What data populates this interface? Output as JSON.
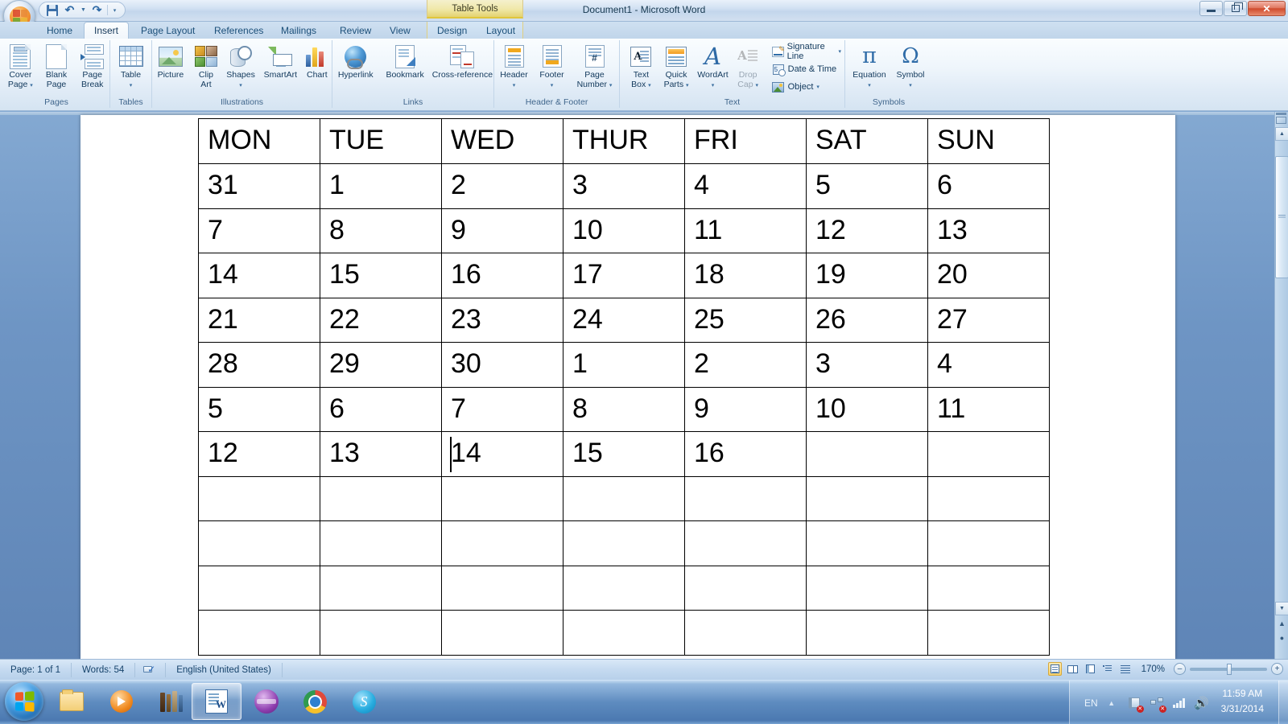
{
  "window": {
    "title": "Document1 - Microsoft Word",
    "contextual_tab_group": "Table Tools",
    "minimize_label": "Minimize",
    "restore_label": "Restore",
    "close_label": "Close"
  },
  "quick_access": {
    "save": "save-icon",
    "undo": "undo-icon",
    "redo": "redo-icon",
    "customize": "customize-icon"
  },
  "tabs": [
    {
      "label": "Home",
      "active": false
    },
    {
      "label": "Insert",
      "active": true
    },
    {
      "label": "Page Layout",
      "active": false
    },
    {
      "label": "References",
      "active": false
    },
    {
      "label": "Mailings",
      "active": false
    },
    {
      "label": "Review",
      "active": false
    },
    {
      "label": "View",
      "active": false
    },
    {
      "label": "Design",
      "active": false
    },
    {
      "label": "Layout",
      "active": false
    }
  ],
  "ribbon": {
    "groups": [
      {
        "name": "Pages",
        "buttons": [
          {
            "label": "Cover\nPage",
            "label_l1": "Cover",
            "label_l2": "Page",
            "dropdown": true
          },
          {
            "label_l1": "Blank",
            "label_l2": "Page",
            "dropdown": false
          },
          {
            "label_l1": "Page",
            "label_l2": "Break",
            "dropdown": false
          }
        ]
      },
      {
        "name": "Tables",
        "buttons": [
          {
            "label_l1": "Table",
            "label_l2": "",
            "dropdown": true
          }
        ]
      },
      {
        "name": "Illustrations",
        "buttons": [
          {
            "label_l1": "Picture",
            "label_l2": "",
            "dropdown": false
          },
          {
            "label_l1": "Clip",
            "label_l2": "Art",
            "dropdown": false
          },
          {
            "label_l1": "Shapes",
            "label_l2": "",
            "dropdown": true
          },
          {
            "label_l1": "SmartArt",
            "label_l2": "",
            "dropdown": false
          },
          {
            "label_l1": "Chart",
            "label_l2": "",
            "dropdown": false
          }
        ]
      },
      {
        "name": "Links",
        "buttons": [
          {
            "label_l1": "Hyperlink",
            "label_l2": "",
            "dropdown": false
          },
          {
            "label_l1": "Bookmark",
            "label_l2": "",
            "dropdown": false
          },
          {
            "label_l1": "Cross-reference",
            "label_l2": "",
            "dropdown": false
          }
        ]
      },
      {
        "name": "Header & Footer",
        "buttons": [
          {
            "label_l1": "Header",
            "label_l2": "",
            "dropdown": true
          },
          {
            "label_l1": "Footer",
            "label_l2": "",
            "dropdown": true
          },
          {
            "label_l1": "Page",
            "label_l2": "Number",
            "dropdown": true
          }
        ]
      },
      {
        "name": "Text",
        "buttons": [
          {
            "label_l1": "Text",
            "label_l2": "Box",
            "dropdown": true
          },
          {
            "label_l1": "Quick",
            "label_l2": "Parts",
            "dropdown": true
          },
          {
            "label_l1": "WordArt",
            "label_l2": "",
            "dropdown": true
          },
          {
            "label_l1": "Drop",
            "label_l2": "Cap",
            "dropdown": true,
            "disabled": true
          }
        ],
        "small_buttons": [
          {
            "label": "Signature Line",
            "dropdown": true
          },
          {
            "label": "Date & Time",
            "dropdown": false
          },
          {
            "label": "Object",
            "dropdown": true
          }
        ]
      },
      {
        "name": "Symbols",
        "buttons": [
          {
            "label_l1": "Equation",
            "label_l2": "",
            "dropdown": true
          },
          {
            "label_l1": "Symbol",
            "label_l2": "",
            "dropdown": true
          }
        ]
      }
    ]
  },
  "document": {
    "table": {
      "header": [
        "MON",
        "TUE",
        "WED",
        "THUR",
        "FRI",
        "SAT",
        "SUN"
      ],
      "rows": [
        [
          "31",
          "1",
          "2",
          "3",
          "4",
          "5",
          "6"
        ],
        [
          "7",
          "8",
          "9",
          "10",
          "11",
          "12",
          "13"
        ],
        [
          "14",
          "15",
          "16",
          "17",
          "18",
          "19",
          "20"
        ],
        [
          "21",
          "22",
          "23",
          "24",
          "25",
          "26",
          "27"
        ],
        [
          "28",
          "29",
          "30",
          "1",
          "2",
          "3",
          "4"
        ],
        [
          "5",
          "6",
          "7",
          "8",
          "9",
          "10",
          "11"
        ],
        [
          "12",
          "13",
          "14",
          "15",
          "16",
          "",
          ""
        ],
        [
          "",
          "",
          "",
          "",
          "",
          "",
          ""
        ],
        [
          "",
          "",
          "",
          "",
          "",
          "",
          ""
        ],
        [
          "",
          "",
          "",
          "",
          "",
          "",
          ""
        ],
        [
          "",
          "",
          "",
          "",
          "",
          "",
          ""
        ]
      ],
      "caret_row": 6,
      "caret_col": 2
    }
  },
  "statusbar": {
    "page": "Page: 1 of 1",
    "words": "Words: 54",
    "proofing_icon": "proofing-errors-icon",
    "language": "English (United States)",
    "zoom": "170%",
    "zoom_out": "–",
    "zoom_in": "+",
    "views": [
      {
        "name": "print-layout",
        "selected": true
      },
      {
        "name": "full-screen-reading",
        "selected": false
      },
      {
        "name": "web-layout",
        "selected": false
      },
      {
        "name": "outline",
        "selected": false
      },
      {
        "name": "draft",
        "selected": false
      }
    ]
  },
  "taskbar": {
    "start": "start-orb",
    "items": [
      {
        "name": "windows-explorer",
        "icon": "folder-icon",
        "active": false
      },
      {
        "name": "windows-media-player",
        "icon": "media-player-icon",
        "active": false
      },
      {
        "name": "calibre",
        "icon": "books-icon",
        "active": false
      },
      {
        "name": "microsoft-word",
        "icon": "word-icon",
        "active": true
      },
      {
        "name": "nero",
        "icon": "purple-disc-icon",
        "active": false
      },
      {
        "name": "google-chrome",
        "icon": "chrome-icon",
        "active": false
      },
      {
        "name": "skype",
        "icon": "skype-icon",
        "active": false
      }
    ],
    "tray": {
      "language": "EN",
      "show_hidden": "chevron-up-icon",
      "action_center": "flag-error-icon",
      "network": "network-error-icon",
      "signal": "signal-bars-icon",
      "volume": "speaker-icon",
      "time": "11:59 AM",
      "date": "3/31/2014"
    }
  },
  "colors": {
    "accent": "#1b4f79",
    "ribbon_bg": "#eef5fb",
    "titlebar": "#d3e2f3",
    "contextual": "#e4d270",
    "close_red": "#cf4a2d"
  }
}
